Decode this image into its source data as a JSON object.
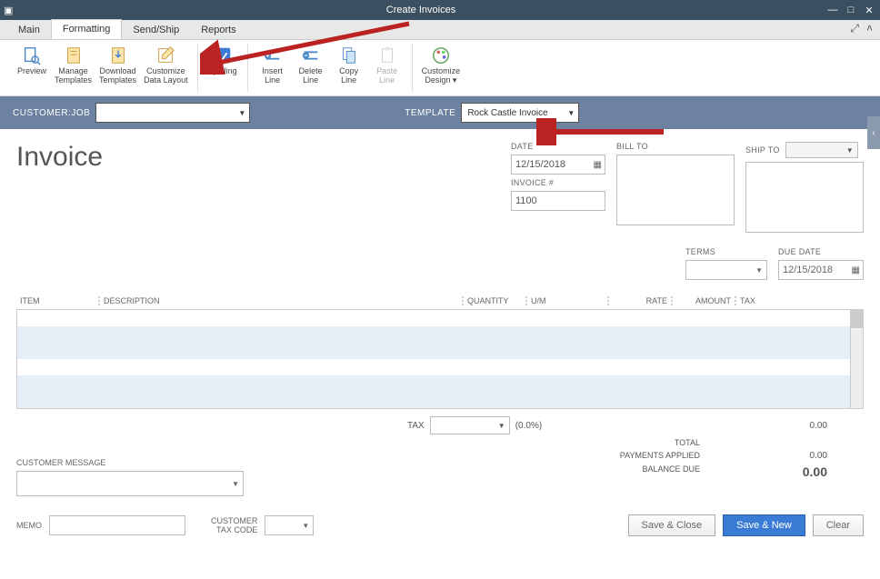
{
  "window": {
    "title": "Create Invoices"
  },
  "tabs": {
    "main": "Main",
    "formatting": "Formatting",
    "sendship": "Send/Ship",
    "reports": "Reports"
  },
  "ribbon": {
    "preview": "Preview",
    "manage_templates": "Manage\nTemplates",
    "download_templates": "Download\nTemplates",
    "customize_layout": "Customize\nData Layout",
    "spelling": "Spelling",
    "insert_line": "Insert\nLine",
    "delete_line": "Delete\nLine",
    "copy_line": "Copy\nLine",
    "paste_line": "Paste\nLine",
    "customize_design": "Customize\nDesign ▾"
  },
  "custbar": {
    "customer_label": "CUSTOMER:JOB",
    "template_label": "TEMPLATE",
    "template_value": "Rock Castle Invoice"
  },
  "form": {
    "title": "Invoice",
    "date_label": "DATE",
    "date_value": "12/15/2018",
    "invnum_label": "INVOICE #",
    "invnum_value": "1100",
    "billto_label": "BILL TO",
    "shipto_label": "SHIP TO",
    "terms_label": "TERMS",
    "duedate_label": "DUE DATE",
    "duedate_value": "12/15/2018"
  },
  "cols": {
    "item": "ITEM",
    "desc": "DESCRIPTION",
    "qty": "QUANTITY",
    "um": "U/M",
    "rate": "RATE",
    "amount": "AMOUNT",
    "tax": "TAX"
  },
  "totals": {
    "tax_label": "TAX",
    "tax_pct": "(0.0%)",
    "tax_amt": "0.00",
    "total_label": "TOTAL",
    "payments_label": "PAYMENTS APPLIED",
    "payments_amt": "0.00",
    "balance_label": "BALANCE DUE",
    "balance_amt": "0.00"
  },
  "custmsg": {
    "label": "CUSTOMER MESSAGE"
  },
  "bottom": {
    "memo_label": "MEMO",
    "taxcode_label": "CUSTOMER\nTAX CODE",
    "save_close": "Save & Close",
    "save_new": "Save & New",
    "clear": "Clear"
  }
}
